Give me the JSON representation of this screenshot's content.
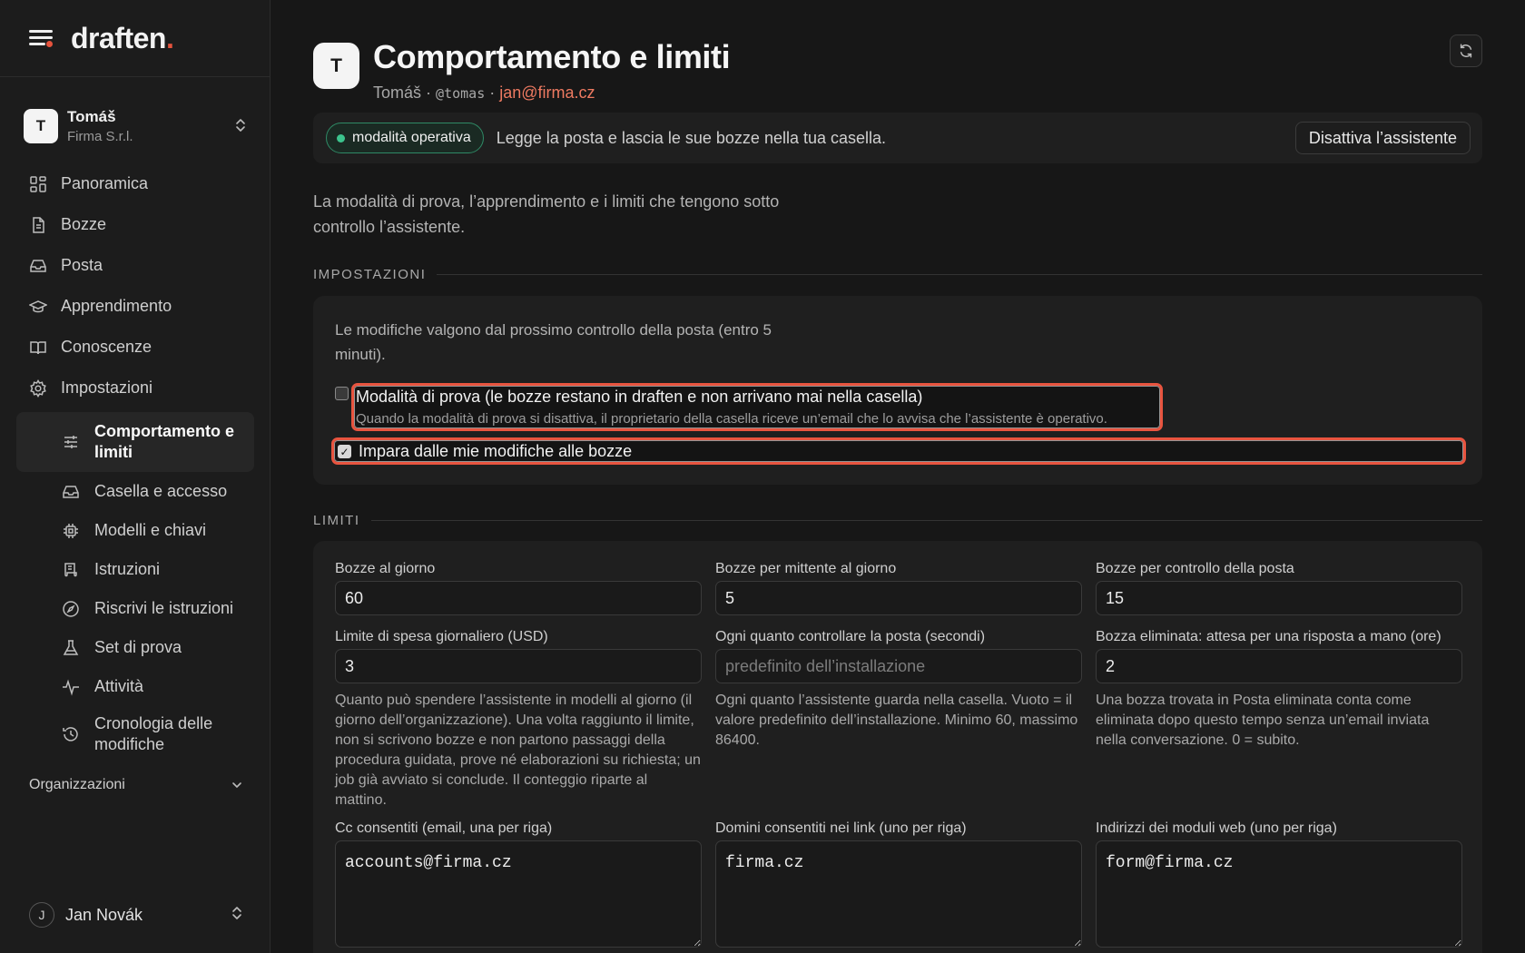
{
  "app": {
    "logo_text": "draften",
    "logo_dot": "."
  },
  "org": {
    "initial": "T",
    "name": "Tomáš",
    "company": "Firma S.r.l."
  },
  "nav": {
    "items": [
      {
        "label": "Panoramica",
        "icon": "grid-icon"
      },
      {
        "label": "Bozze",
        "icon": "document-icon"
      },
      {
        "label": "Posta",
        "icon": "inbox-icon"
      },
      {
        "label": "Apprendimento",
        "icon": "graduation-cap-icon"
      },
      {
        "label": "Conoscenze",
        "icon": "book-icon"
      },
      {
        "label": "Impostazioni",
        "icon": "gear-icon"
      }
    ],
    "subitems": [
      {
        "label": "Comportamento e limiti",
        "icon": "sliders-icon",
        "active": true
      },
      {
        "label": "Casella e accesso",
        "icon": "inbox-icon"
      },
      {
        "label": "Modelli e chiavi",
        "icon": "chip-icon"
      },
      {
        "label": "Istruzioni",
        "icon": "scroll-icon"
      },
      {
        "label": "Riscrivi le istruzioni",
        "icon": "compass-icon"
      },
      {
        "label": "Set di prova",
        "icon": "flask-icon"
      },
      {
        "label": "Attività",
        "icon": "activity-icon"
      },
      {
        "label": "Cronologia delle modifiche",
        "icon": "history-icon"
      }
    ],
    "organizations_label": "Organizzazioni"
  },
  "user": {
    "initial": "J",
    "name": "Jan Novák"
  },
  "header": {
    "avatar_initial": "T",
    "title": "Comportamento e limiti",
    "sub_name": "Tomáš",
    "sep": "·",
    "handle": "@tomas",
    "email": "jan@firma.cz"
  },
  "status": {
    "badge": "modalità operativa",
    "text": "Legge la posta e lascia le sue bozze nella tua casella.",
    "deactivate_label": "Disattiva l’assistente",
    "accent": "#3cc48d"
  },
  "intro": "La modalità di prova, l’apprendimento e i limiti che tengono sotto controllo l’assistente.",
  "settings": {
    "heading": "IMPOSTAZIONI",
    "note": "Le modifiche valgono dal prossimo controllo della posta (entro 5 minuti).",
    "trial_mode": {
      "label": "Modalità di prova (le bozze restano in draften e non arrivano mai nella casella)",
      "help": "Quando la modalità di prova si disattiva, il proprietario della casella riceve un’email che lo avvisa che l’assistente è operativo.",
      "checked": false
    },
    "learn": {
      "label": "Impara dalle mie modifiche alle bozze",
      "checked": true
    }
  },
  "limits": {
    "heading": "LIMITI",
    "drafts_per_day": {
      "label": "Bozze al giorno",
      "value": "60"
    },
    "drafts_per_sender": {
      "label": "Bozze per mittente al giorno",
      "value": "5"
    },
    "drafts_per_check": {
      "label": "Bozze per controllo della posta",
      "value": "15"
    },
    "daily_spend": {
      "label": "Limite di spesa giornaliero (USD)",
      "value": "3",
      "help": "Quanto può spendere l’assistente in modelli al giorno (il giorno dell’organizzazione). Una volta raggiunto il limite, non si scrivono bozze e non partono passaggi della procedura guidata, prove né elaborazioni su richiesta; un job già avviato si conclude. Il conteggio riparte al mattino."
    },
    "poll_interval": {
      "label": "Ogni quanto controllare la posta (secondi)",
      "value": "",
      "placeholder": "predefinito dell’installazione",
      "help": "Ogni quanto l’assistente guarda nella casella. Vuoto = il valore predefinito dell’installazione. Minimo 60, massimo 86400."
    },
    "deleted_wait": {
      "label": "Bozza eliminata: attesa per una risposta a mano (ore)",
      "value": "2",
      "help": "Una bozza trovata in Posta eliminata conta come eliminata dopo questo tempo senza un’email inviata nella conversazione. 0 = subito."
    },
    "allowed_cc": {
      "label": "Cc consentiti (email, una per riga)",
      "value": "accounts@firma.cz"
    },
    "allowed_domains": {
      "label": "Domini consentiti nei link (uno per riga)",
      "value": "firma.cz"
    },
    "web_forms": {
      "label": "Indirizzi dei moduli web (uno per riga)",
      "value": "form@firma.cz"
    }
  }
}
